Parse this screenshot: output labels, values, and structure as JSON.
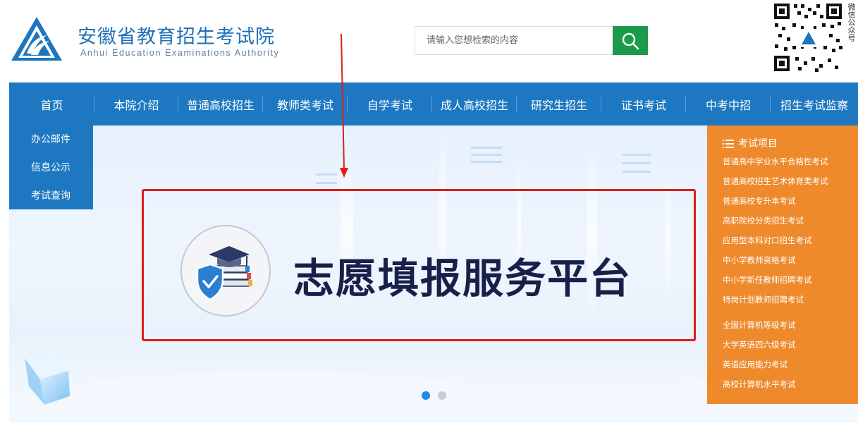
{
  "header": {
    "title": "安徽省教育招生考试院",
    "subtitle": "Anhui Education Examinations Authority",
    "search_placeholder": "请输入您想检索的内容",
    "qr_label": "微信公众号"
  },
  "nav": {
    "items": [
      {
        "label": "首页"
      },
      {
        "label": "本院介绍"
      },
      {
        "label": "普通高校招生"
      },
      {
        "label": "教师类考试"
      },
      {
        "label": "自学考试"
      },
      {
        "label": "成人高校招生"
      },
      {
        "label": "研究生招生"
      },
      {
        "label": "证书考试"
      },
      {
        "label": "中考中招"
      },
      {
        "label": "招生考试监察"
      }
    ]
  },
  "side_left": {
    "items": [
      {
        "label": "办公邮件"
      },
      {
        "label": "信息公示"
      },
      {
        "label": "考试查询"
      }
    ]
  },
  "side_right": {
    "heading": "考试项目",
    "items": [
      {
        "label": "普通高中学业水平合格性考试"
      },
      {
        "label": "普通高校招生艺术体育类考试"
      },
      {
        "label": "普通高校专升本考试"
      },
      {
        "label": "高职院校分类招生考试"
      },
      {
        "label": "应用型本科对口招生考试"
      },
      {
        "label": "中小学教师资格考试"
      },
      {
        "label": "中小学新任教师招聘考试"
      },
      {
        "label": "特岗计划教师招聘考试"
      },
      {
        "label": "全国计算机等级考试"
      },
      {
        "label": "大学英语四六级考试"
      },
      {
        "label": "英语应用能力考试"
      },
      {
        "label": "高校计算机水平考试"
      }
    ]
  },
  "banner": {
    "title": "志愿填报服务平台",
    "slides_total": 2,
    "active_slide": 1
  },
  "colors": {
    "brand_blue": "#1d78c1",
    "search_green": "#1a9a4a",
    "side_orange": "#ee8a2c",
    "annotation_red": "#e01c1c",
    "banner_title": "#18204a"
  }
}
